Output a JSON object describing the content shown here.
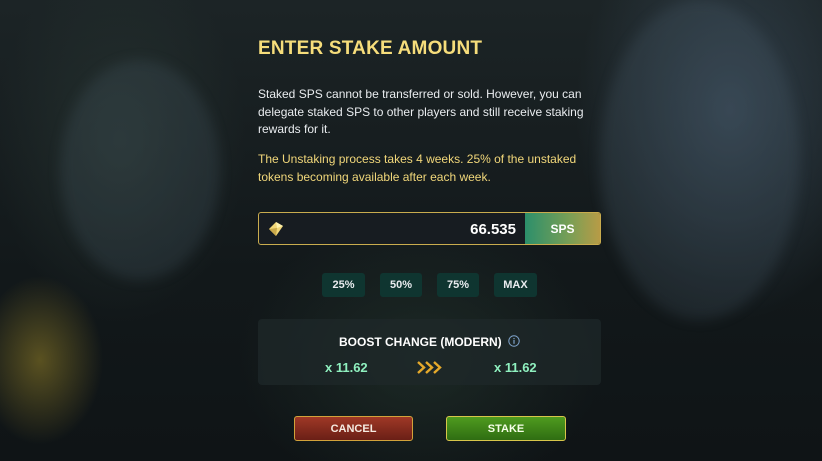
{
  "dialog": {
    "title": "ENTER STAKE AMOUNT",
    "description": "Staked SPS cannot be transferred or sold. However, you can delegate staked SPS to other players and still receive staking rewards for it.",
    "unstake_note": "The Unstaking process takes 4 weeks. 25% of the unstaked tokens becoming available after each week."
  },
  "stake_input": {
    "value": "66.535",
    "currency": "SPS",
    "token_icon": "sps-token-icon"
  },
  "percent_buttons": [
    "25%",
    "50%",
    "75%",
    "MAX"
  ],
  "boost": {
    "title": "BOOST CHANGE (MODERN)",
    "info_icon": "info-icon",
    "current": "x 11.62",
    "arrow_icon": "triple-chevron-right-icon",
    "new": "x 11.62"
  },
  "actions": {
    "cancel_label": "CANCEL",
    "stake_label": "STAKE"
  },
  "colors": {
    "title_gold": "#f6dd7b",
    "note_gold": "#f1d77a",
    "boost_green": "#8ff0bf",
    "cancel_red": "#9f3826",
    "stake_green": "#4f9b1f"
  }
}
